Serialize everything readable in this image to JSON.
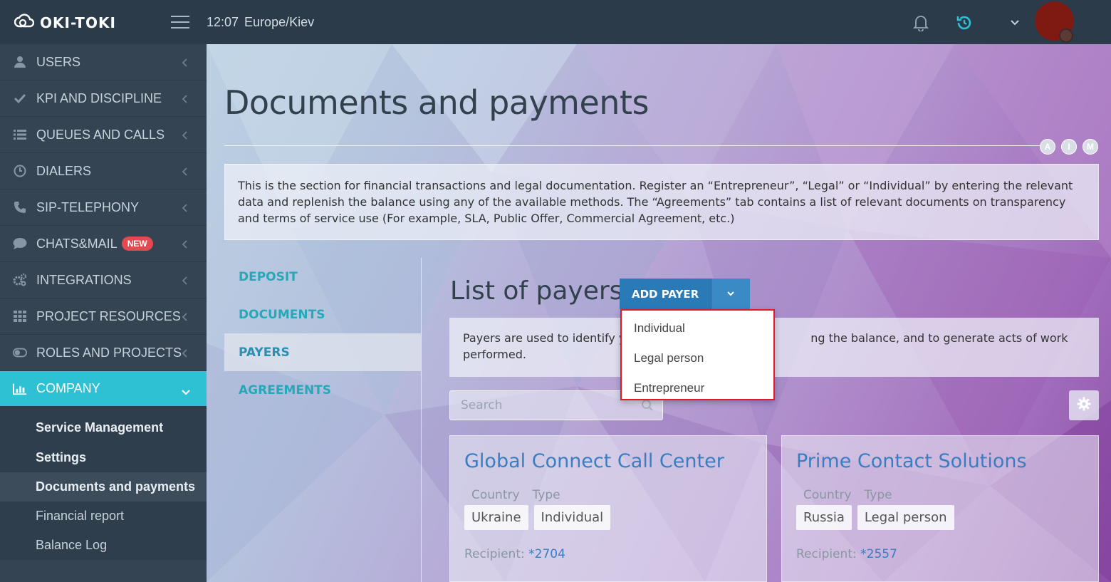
{
  "app": {
    "name": "OKI-TOKI",
    "time": "12:07",
    "timezone": "Europe/Kiev"
  },
  "colors": {
    "accent": "#2ec0d3",
    "primary_button": "#2b7ab8",
    "badge": "#e24a4f",
    "highlight_border": "#e01b24"
  },
  "sidebar": {
    "items": [
      {
        "label": "USERS",
        "icon": "user-icon"
      },
      {
        "label": "KPI AND DISCIPLINE",
        "icon": "check-icon"
      },
      {
        "label": "QUEUES AND CALLS",
        "icon": "list-icon"
      },
      {
        "label": "DIALERS",
        "icon": "clock-icon"
      },
      {
        "label": "SIP-TELEPHONY",
        "icon": "phone-icon"
      },
      {
        "label": "CHATS&MAIL",
        "icon": "chat-icon",
        "badge": "NEW"
      },
      {
        "label": "INTEGRATIONS",
        "icon": "cogs-icon"
      },
      {
        "label": "PROJECT RESOURCES",
        "icon": "grid-icon"
      },
      {
        "label": "ROLES AND PROJECTS",
        "icon": "toggle-icon"
      },
      {
        "label": "COMPANY",
        "icon": "bar-chart-icon"
      }
    ],
    "subitems": [
      {
        "label": "Service Management"
      },
      {
        "label": "Settings"
      },
      {
        "label": "Documents and payments"
      },
      {
        "label": "Financial report"
      },
      {
        "label": "Balance Log"
      }
    ]
  },
  "page": {
    "title": "Documents and payments",
    "aim": [
      "A",
      "I",
      "M"
    ],
    "info": "This is the section for financial transactions and legal documentation. Register an “Entrepreneur”, “Legal” or “Individual” by entering the relevant data and replenish the balance using any of the available methods. The “Agreements” tab contains a list of relevant documents on transparency and terms of service use (For example, SLA, Public Offer, Commercial Agreement, etc.)"
  },
  "tabs": [
    "DEPOSIT",
    "DOCUMENTS",
    "PAYERS",
    "AGREEMENTS"
  ],
  "payers": {
    "title": "List of payers",
    "add_button": "ADD PAYER",
    "dropdown": [
      "Individual",
      "Legal person",
      "Entrepreneur"
    ],
    "info_visible_start": "Payers are used to identify yo",
    "info_visible_end": "ng the balance, and to generate acts of work",
    "info_line2": "performed.",
    "search_placeholder": "Search",
    "country_label": "Country",
    "type_label": "Type",
    "recipient_label": "Recipient:",
    "cards": [
      {
        "name": "Global Connect Call Center",
        "country": "Ukraine",
        "type": "Individual",
        "recipient": "*2704"
      },
      {
        "name": "Prime Contact Solutions",
        "country": "Russia",
        "type": "Legal person",
        "recipient": "*2557"
      }
    ]
  }
}
